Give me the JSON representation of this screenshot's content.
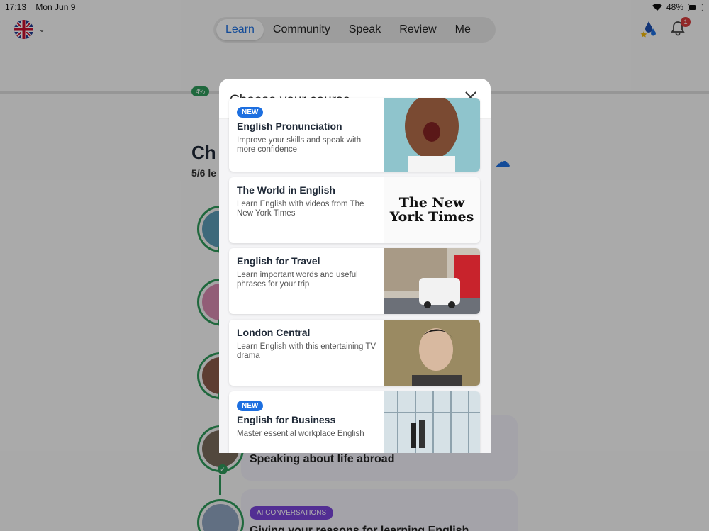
{
  "status_bar": {
    "time": "17:13",
    "date": "Mon Jun 9",
    "battery": "48%"
  },
  "nav": {
    "tabs": [
      {
        "label": "Learn"
      },
      {
        "label": "Community"
      },
      {
        "label": "Speak"
      },
      {
        "label": "Review"
      },
      {
        "label": "Me"
      }
    ],
    "notifications": "1"
  },
  "background": {
    "progress": "4%",
    "chapter_title": "Ch",
    "chapter_sub": "5/6 le",
    "lesson_title": "Speaking about life abroad",
    "ai_tag": "AI CONVERSATIONS",
    "cut_text": "Giving your reasons for learning English"
  },
  "modal": {
    "title": "Choose your course",
    "courses": [
      {
        "tag": "NEW",
        "name": "English Pronunciation",
        "desc": "Improve your skills and speak with more confidence"
      },
      {
        "name": "The World in English",
        "desc": "Learn English with videos from The New York Times",
        "logo": "The New York Times"
      },
      {
        "name": "English for Travel",
        "desc": "Learn important words and useful phrases for your trip"
      },
      {
        "name": "London Central",
        "desc": "Learn English with this entertaining TV drama"
      },
      {
        "tag": "NEW",
        "name": "English for Business",
        "desc": "Master essential workplace English"
      }
    ]
  }
}
